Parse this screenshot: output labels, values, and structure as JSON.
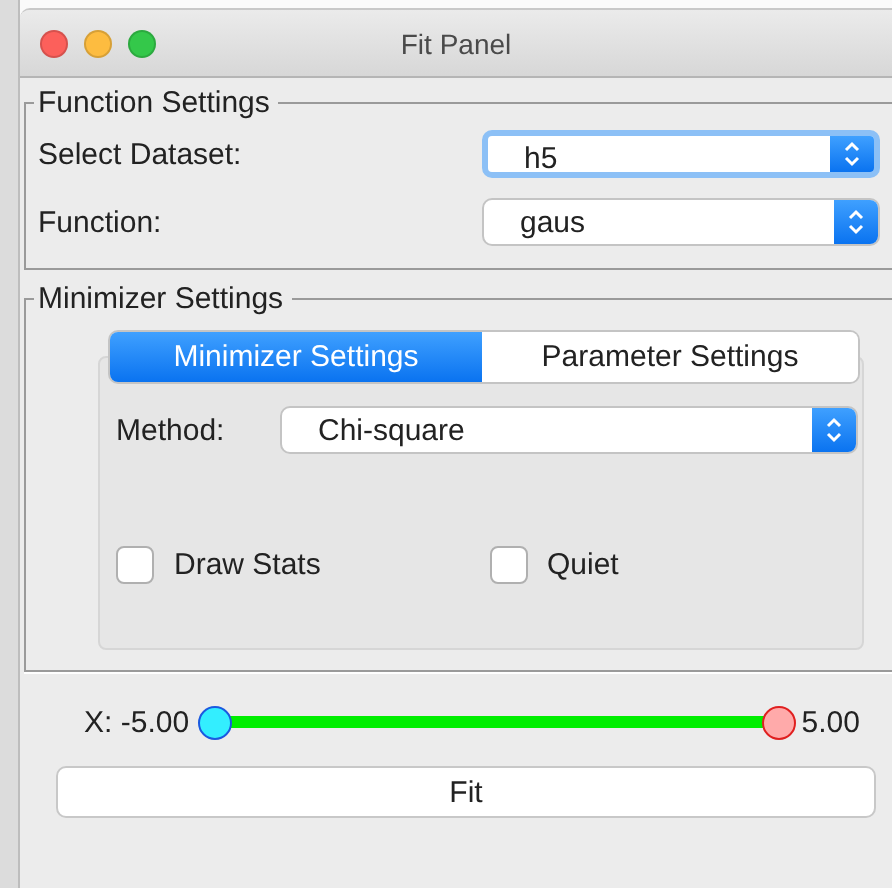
{
  "window": {
    "title": "Fit Panel"
  },
  "function_settings": {
    "title": "Function Settings",
    "fields": [
      {
        "label": "Select Dataset:",
        "value": "h5",
        "focused": true
      },
      {
        "label": "Function:",
        "value": "gaus",
        "focused": false
      }
    ]
  },
  "minimizer_settings": {
    "title": "Minimizer Settings",
    "tabs": [
      {
        "label": "Minimizer Settings",
        "selected": true
      },
      {
        "label": "Parameter Settings",
        "selected": false
      }
    ],
    "method": {
      "label": "Method:",
      "value": "Chi-square"
    },
    "options": [
      {
        "label": "Draw Stats",
        "checked": false
      },
      {
        "label": "Quiet",
        "checked": false
      }
    ]
  },
  "range": {
    "label": "X:",
    "min_reading": "-5.00",
    "max_reading": "5.00",
    "handles": [
      {
        "level": 0
      },
      {
        "level": 1
      }
    ]
  },
  "buttons": [
    {
      "label": "Fit"
    }
  ]
}
